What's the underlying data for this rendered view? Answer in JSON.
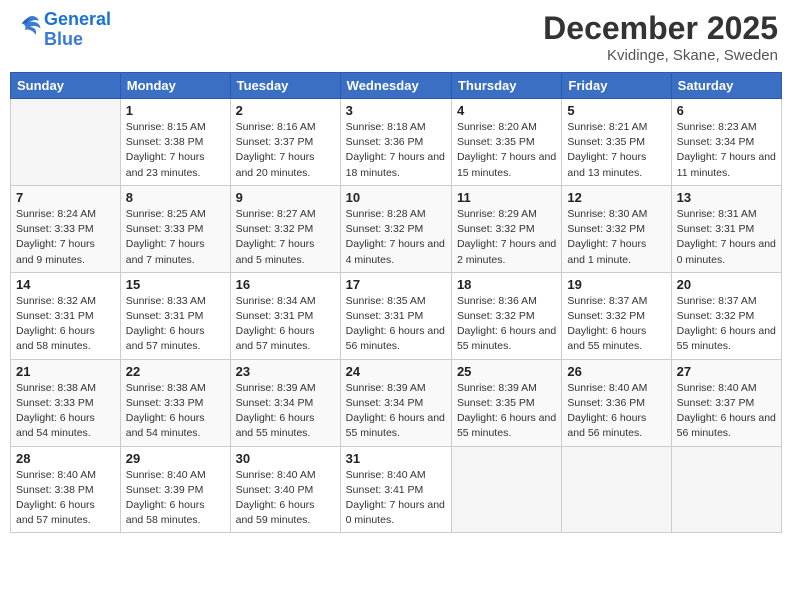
{
  "logo": {
    "line1": "General",
    "line2": "Blue"
  },
  "title": "December 2025",
  "location": "Kvidinge, Skane, Sweden",
  "weekdays": [
    "Sunday",
    "Monday",
    "Tuesday",
    "Wednesday",
    "Thursday",
    "Friday",
    "Saturday"
  ],
  "weeks": [
    [
      {
        "day": "",
        "empty": true
      },
      {
        "day": "1",
        "sunrise": "Sunrise: 8:15 AM",
        "sunset": "Sunset: 3:38 PM",
        "daylight": "Daylight: 7 hours and 23 minutes."
      },
      {
        "day": "2",
        "sunrise": "Sunrise: 8:16 AM",
        "sunset": "Sunset: 3:37 PM",
        "daylight": "Daylight: 7 hours and 20 minutes."
      },
      {
        "day": "3",
        "sunrise": "Sunrise: 8:18 AM",
        "sunset": "Sunset: 3:36 PM",
        "daylight": "Daylight: 7 hours and 18 minutes."
      },
      {
        "day": "4",
        "sunrise": "Sunrise: 8:20 AM",
        "sunset": "Sunset: 3:35 PM",
        "daylight": "Daylight: 7 hours and 15 minutes."
      },
      {
        "day": "5",
        "sunrise": "Sunrise: 8:21 AM",
        "sunset": "Sunset: 3:35 PM",
        "daylight": "Daylight: 7 hours and 13 minutes."
      },
      {
        "day": "6",
        "sunrise": "Sunrise: 8:23 AM",
        "sunset": "Sunset: 3:34 PM",
        "daylight": "Daylight: 7 hours and 11 minutes."
      }
    ],
    [
      {
        "day": "7",
        "sunrise": "Sunrise: 8:24 AM",
        "sunset": "Sunset: 3:33 PM",
        "daylight": "Daylight: 7 hours and 9 minutes."
      },
      {
        "day": "8",
        "sunrise": "Sunrise: 8:25 AM",
        "sunset": "Sunset: 3:33 PM",
        "daylight": "Daylight: 7 hours and 7 minutes."
      },
      {
        "day": "9",
        "sunrise": "Sunrise: 8:27 AM",
        "sunset": "Sunset: 3:32 PM",
        "daylight": "Daylight: 7 hours and 5 minutes."
      },
      {
        "day": "10",
        "sunrise": "Sunrise: 8:28 AM",
        "sunset": "Sunset: 3:32 PM",
        "daylight": "Daylight: 7 hours and 4 minutes."
      },
      {
        "day": "11",
        "sunrise": "Sunrise: 8:29 AM",
        "sunset": "Sunset: 3:32 PM",
        "daylight": "Daylight: 7 hours and 2 minutes."
      },
      {
        "day": "12",
        "sunrise": "Sunrise: 8:30 AM",
        "sunset": "Sunset: 3:32 PM",
        "daylight": "Daylight: 7 hours and 1 minute."
      },
      {
        "day": "13",
        "sunrise": "Sunrise: 8:31 AM",
        "sunset": "Sunset: 3:31 PM",
        "daylight": "Daylight: 7 hours and 0 minutes."
      }
    ],
    [
      {
        "day": "14",
        "sunrise": "Sunrise: 8:32 AM",
        "sunset": "Sunset: 3:31 PM",
        "daylight": "Daylight: 6 hours and 58 minutes."
      },
      {
        "day": "15",
        "sunrise": "Sunrise: 8:33 AM",
        "sunset": "Sunset: 3:31 PM",
        "daylight": "Daylight: 6 hours and 57 minutes."
      },
      {
        "day": "16",
        "sunrise": "Sunrise: 8:34 AM",
        "sunset": "Sunset: 3:31 PM",
        "daylight": "Daylight: 6 hours and 57 minutes."
      },
      {
        "day": "17",
        "sunrise": "Sunrise: 8:35 AM",
        "sunset": "Sunset: 3:31 PM",
        "daylight": "Daylight: 6 hours and 56 minutes."
      },
      {
        "day": "18",
        "sunrise": "Sunrise: 8:36 AM",
        "sunset": "Sunset: 3:32 PM",
        "daylight": "Daylight: 6 hours and 55 minutes."
      },
      {
        "day": "19",
        "sunrise": "Sunrise: 8:37 AM",
        "sunset": "Sunset: 3:32 PM",
        "daylight": "Daylight: 6 hours and 55 minutes."
      },
      {
        "day": "20",
        "sunrise": "Sunrise: 8:37 AM",
        "sunset": "Sunset: 3:32 PM",
        "daylight": "Daylight: 6 hours and 55 minutes."
      }
    ],
    [
      {
        "day": "21",
        "sunrise": "Sunrise: 8:38 AM",
        "sunset": "Sunset: 3:33 PM",
        "daylight": "Daylight: 6 hours and 54 minutes."
      },
      {
        "day": "22",
        "sunrise": "Sunrise: 8:38 AM",
        "sunset": "Sunset: 3:33 PM",
        "daylight": "Daylight: 6 hours and 54 minutes."
      },
      {
        "day": "23",
        "sunrise": "Sunrise: 8:39 AM",
        "sunset": "Sunset: 3:34 PM",
        "daylight": "Daylight: 6 hours and 55 minutes."
      },
      {
        "day": "24",
        "sunrise": "Sunrise: 8:39 AM",
        "sunset": "Sunset: 3:34 PM",
        "daylight": "Daylight: 6 hours and 55 minutes."
      },
      {
        "day": "25",
        "sunrise": "Sunrise: 8:39 AM",
        "sunset": "Sunset: 3:35 PM",
        "daylight": "Daylight: 6 hours and 55 minutes."
      },
      {
        "day": "26",
        "sunrise": "Sunrise: 8:40 AM",
        "sunset": "Sunset: 3:36 PM",
        "daylight": "Daylight: 6 hours and 56 minutes."
      },
      {
        "day": "27",
        "sunrise": "Sunrise: 8:40 AM",
        "sunset": "Sunset: 3:37 PM",
        "daylight": "Daylight: 6 hours and 56 minutes."
      }
    ],
    [
      {
        "day": "28",
        "sunrise": "Sunrise: 8:40 AM",
        "sunset": "Sunset: 3:38 PM",
        "daylight": "Daylight: 6 hours and 57 minutes."
      },
      {
        "day": "29",
        "sunrise": "Sunrise: 8:40 AM",
        "sunset": "Sunset: 3:39 PM",
        "daylight": "Daylight: 6 hours and 58 minutes."
      },
      {
        "day": "30",
        "sunrise": "Sunrise: 8:40 AM",
        "sunset": "Sunset: 3:40 PM",
        "daylight": "Daylight: 6 hours and 59 minutes."
      },
      {
        "day": "31",
        "sunrise": "Sunrise: 8:40 AM",
        "sunset": "Sunset: 3:41 PM",
        "daylight": "Daylight: 7 hours and 0 minutes."
      },
      {
        "day": "",
        "empty": true
      },
      {
        "day": "",
        "empty": true
      },
      {
        "day": "",
        "empty": true
      }
    ]
  ]
}
